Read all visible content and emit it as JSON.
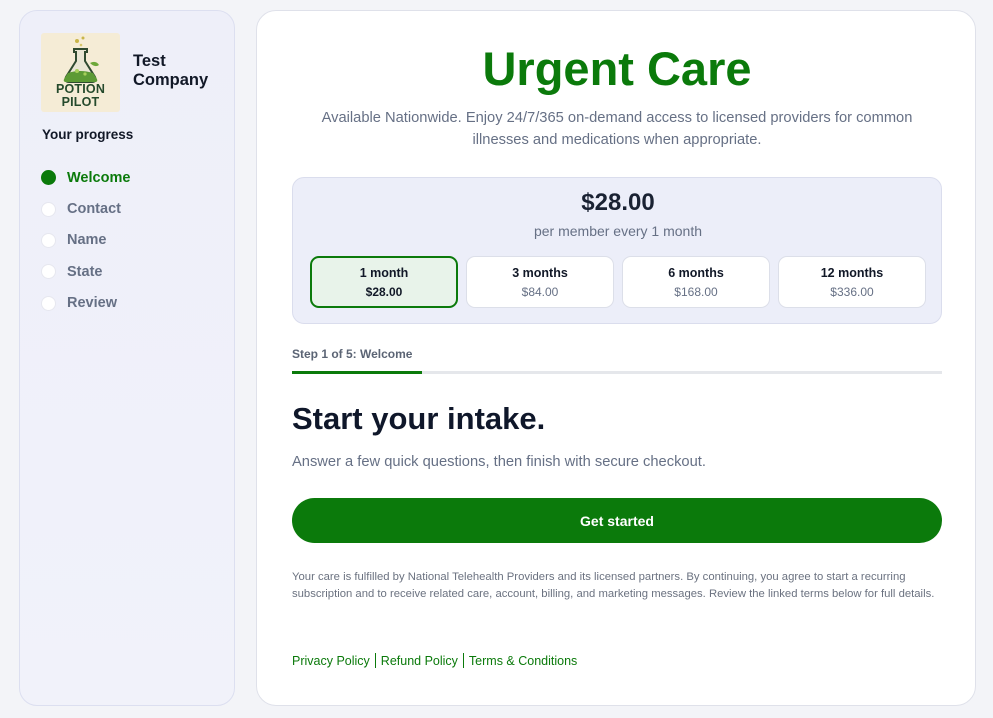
{
  "sidebar": {
    "logo": {
      "line1": "POTION",
      "line2": "PILOT",
      "icon": "potion-flask-icon"
    },
    "company": "Test Company",
    "progress_title": "Your progress",
    "steps": [
      {
        "label": "Welcome",
        "active": true
      },
      {
        "label": "Contact",
        "active": false
      },
      {
        "label": "Name",
        "active": false
      },
      {
        "label": "State",
        "active": false
      },
      {
        "label": "Review",
        "active": false
      }
    ]
  },
  "main": {
    "title": "Urgent Care",
    "subtitle": "Available Nationwide. Enjoy 24/7/365 on-demand access to licensed providers for common illnesses and medications when appropriate.",
    "pricing": {
      "price": "$28.00",
      "period": "per member every 1 month",
      "plans": [
        {
          "name": "1 month",
          "price": "$28.00",
          "selected": true
        },
        {
          "name": "3 months",
          "price": "$84.00",
          "selected": false
        },
        {
          "name": "6 months",
          "price": "$168.00",
          "selected": false
        },
        {
          "name": "12 months",
          "price": "$336.00",
          "selected": false
        }
      ]
    },
    "step_indicator": "Step 1 of 5: Welcome",
    "progress": {
      "current": 1,
      "total": 5
    },
    "intake_title": "Start your intake.",
    "intake_sub": "Answer a few quick questions, then finish with secure checkout.",
    "cta_label": "Get started",
    "disclaimer": "Your care is fulfilled by National Telehealth Providers and its licensed partners. By continuing, you agree to start a recurring subscription and to receive related care, account, billing, and marketing messages. Review the linked terms below for full details.",
    "links": [
      "Privacy Policy",
      "Refund Policy",
      "Terms & Conditions"
    ]
  },
  "colors": {
    "accent": "#0b7a0b",
    "muted": "#667085"
  }
}
